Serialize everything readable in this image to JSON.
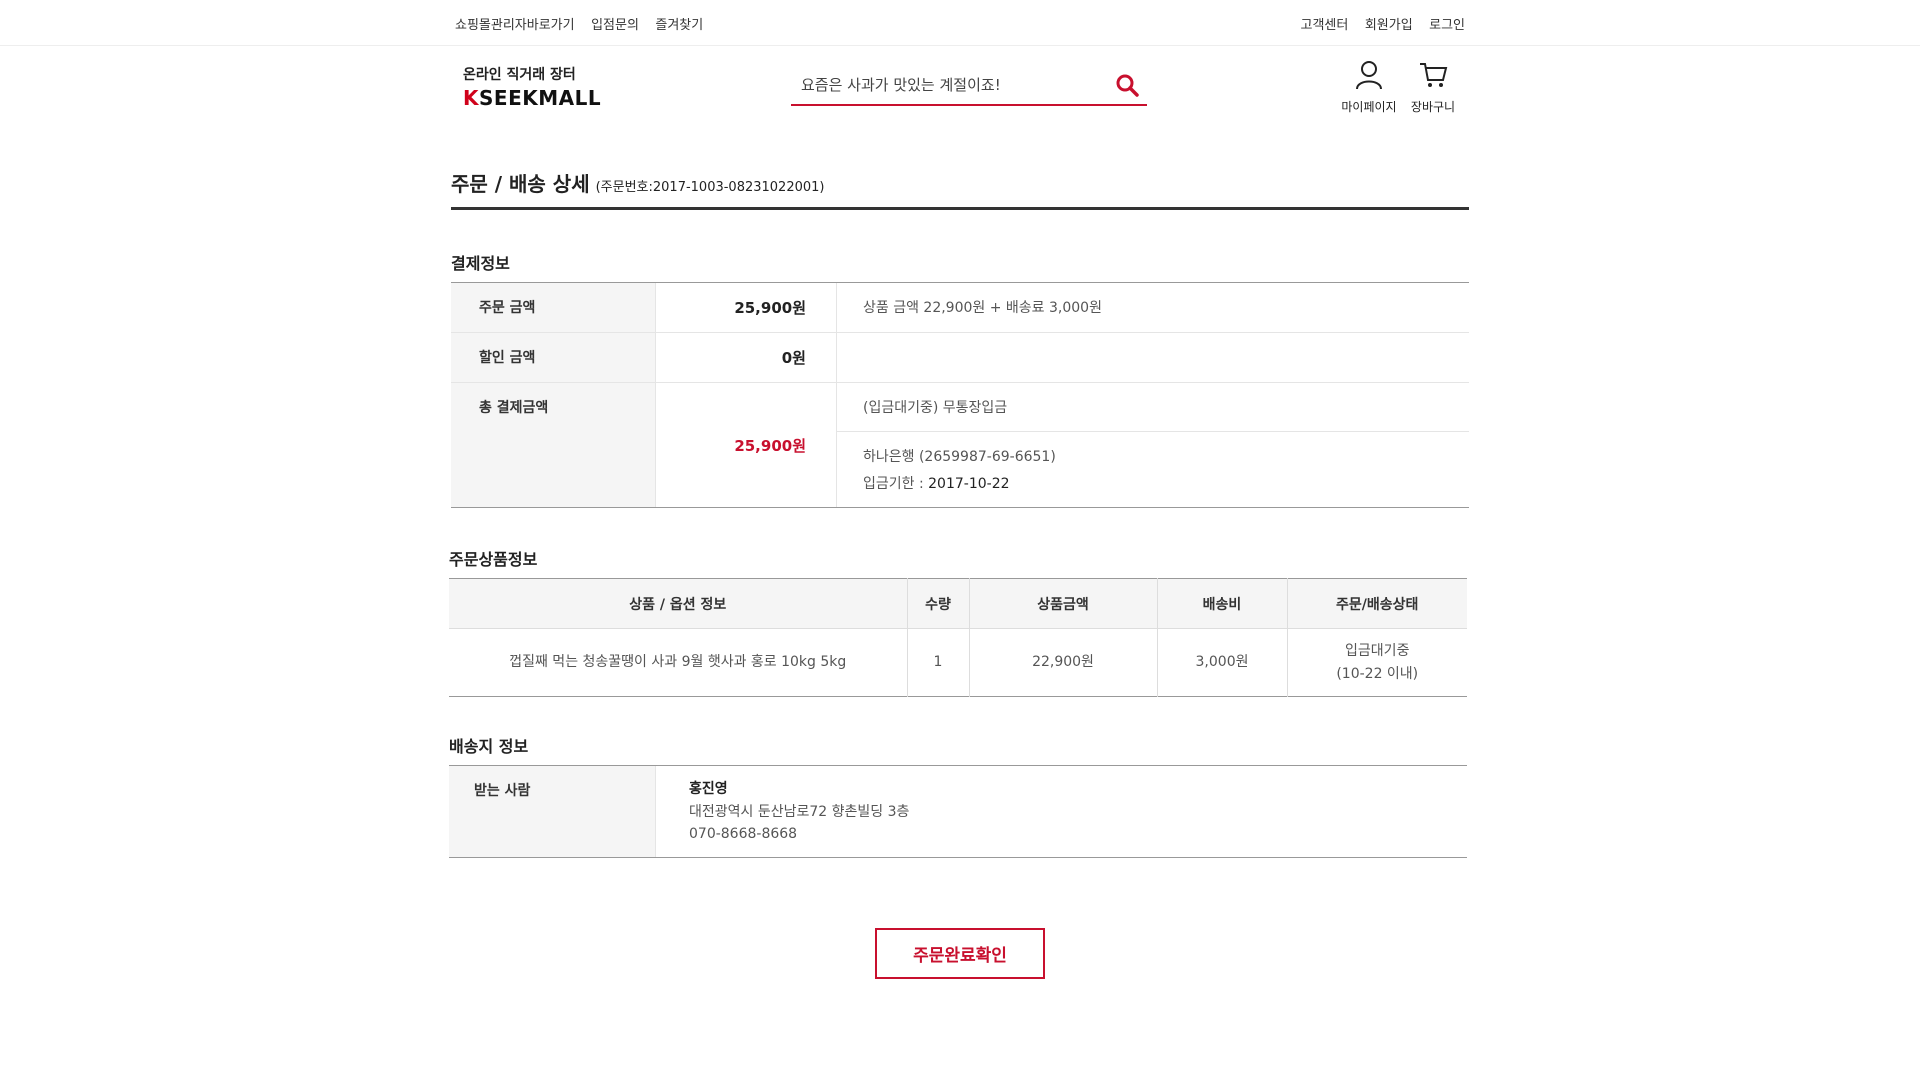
{
  "topbar": {
    "left": [
      "쇼핑몰관리자바로가기",
      "입점문의",
      "즐겨찾기"
    ],
    "right": [
      "고객센터",
      "회원가입",
      "로그인"
    ]
  },
  "header": {
    "logo_sub": "온라인 직거래 장터",
    "logo_k": "K",
    "logo_rest": "SEEKMALL",
    "search_placeholder": "요즘은 사과가 맛있는 계절이죠!",
    "mypage": "마이페이지",
    "cart": "장바구니"
  },
  "page": {
    "title": "주문 / 배송 상세",
    "order_no": "(주문번호:2017-1003-08231022001)"
  },
  "payment": {
    "title": "결제정보",
    "order_amount_label": "주문 금액",
    "order_amount": "25,900원",
    "order_amount_note": "상품 금액 22,900원 + 배송료 3,000원",
    "discount_label": "할인 금액",
    "discount": "0원",
    "total_label": "총 결제금액",
    "total": "25,900원",
    "method": "(입금대기중) 무통장입금",
    "bank": "하나은행 (2659987-69-6651)",
    "deadline_label": "입금기한 :",
    "deadline": "2017-10-22"
  },
  "products": {
    "title": "주문상품정보",
    "headers": [
      "상품 / 옵션 정보",
      "수량",
      "상품금액",
      "배송비",
      "주문/배송상태"
    ],
    "rows": [
      {
        "name": "껍질째 먹는 청송꿀땡이 사과 9월 햇사과 홍로 10kg 5kg",
        "qty": "1",
        "price": "22,900원",
        "shipping": "3,000원",
        "status": "입금대기중",
        "status_sub": "(10-22 이내)"
      }
    ]
  },
  "shipping": {
    "title": "배송지 정보",
    "label": "받는 사람",
    "name": "홍진영",
    "address": "대전광역시 둔산남로72 향촌빌딩 3층",
    "phone": "070-8668-8668"
  },
  "confirm_button": "주문완료확인",
  "colors": {
    "accent": "#c8102e"
  }
}
